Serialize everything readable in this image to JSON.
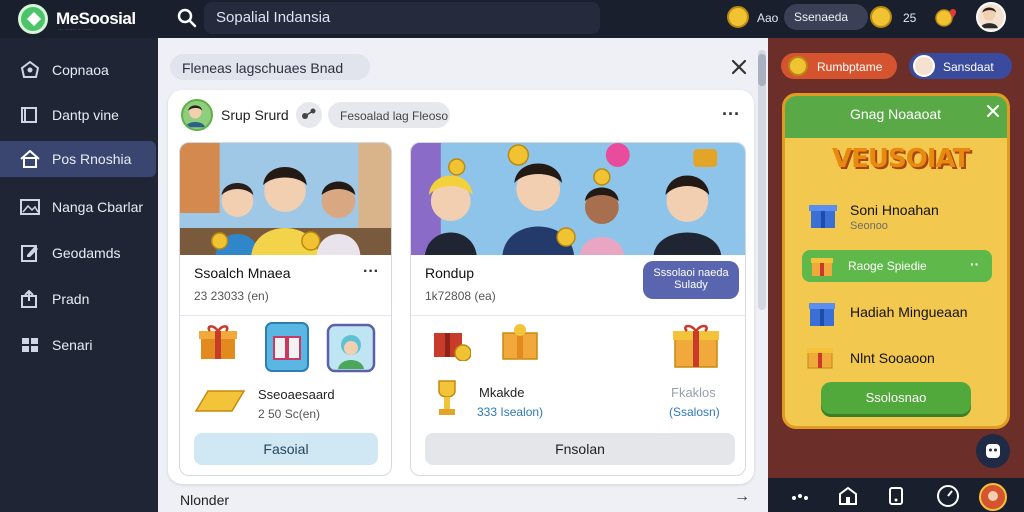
{
  "app": {
    "brand": "MeSoosial",
    "brand_sub": "··· ······· ·· ······"
  },
  "search": {
    "text": "Sopalial Indansia"
  },
  "topbar": {
    "user_label": "Aao",
    "pill_label": "Ssenaeda",
    "count": "25"
  },
  "sidebar": {
    "items": [
      {
        "label": "Copnaoa",
        "icon": "home-shield-icon"
      },
      {
        "label": "Dantp vine",
        "icon": "book-icon"
      },
      {
        "label": "Pos Rnoshia",
        "icon": "house-icon",
        "active": true
      },
      {
        "label": "Nanga Cbarlar",
        "icon": "image-icon"
      },
      {
        "label": "Geodamds",
        "icon": "edit-icon"
      },
      {
        "label": "Pradn",
        "icon": "upload-icon"
      },
      {
        "label": "Senari",
        "icon": "grid-icon"
      }
    ]
  },
  "breadcrumb": {
    "text": "Fleneas lagschuaes Bnad"
  },
  "group": {
    "name": "Srup Srurd",
    "chip": "Fesoalad lag Fleoso"
  },
  "cards": [
    {
      "title": "Ssoalch Mnaea",
      "sub": "23 23033 (en)",
      "rewards": [
        {
          "name": "Sseoaesaard",
          "value": "2 50 Sc(en)"
        }
      ],
      "button": "Fasoial"
    },
    {
      "title": "Rondup",
      "sub": "1k72808 (ea)",
      "join": "Sssolaoi naeda Sulady",
      "rewards": [
        {
          "name": "Mkakde",
          "value": "333 Isealon)"
        },
        {
          "name": "Fkaklos",
          "value": "(Ssalosn)"
        }
      ],
      "button": "Fnsolan"
    }
  ],
  "more_row": {
    "label": "Nlonder",
    "arrow": "→"
  },
  "right": {
    "pill1": "Rumbptame",
    "pill2": "Sansdaat"
  },
  "event": {
    "title": "Gnag Noaaoat",
    "logo": "VEUSOIAT",
    "items": [
      {
        "name": "Soni Hnoahan",
        "sub": "Seonoo"
      },
      {
        "name": "Raoge Spiedie",
        "highlight": true
      },
      {
        "name": "Hadiah Mingueaan"
      },
      {
        "name": "Nlnt Sooaoon"
      }
    ],
    "button": "Ssolosnao"
  },
  "colors": {
    "sidebar_bg": "#1f2535",
    "active_item": "#3a4670",
    "event_panel": "#f3c84e",
    "event_green": "#5fb84a",
    "join_button": "#5a65b0"
  }
}
